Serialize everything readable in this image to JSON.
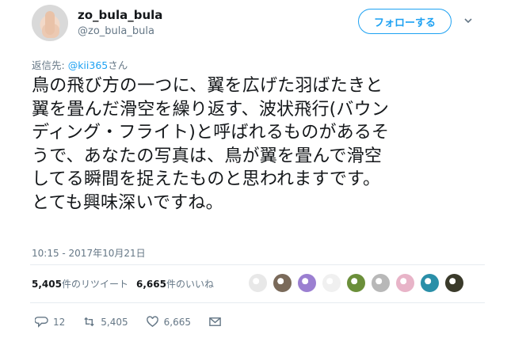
{
  "user": {
    "display_name": "zo_bula_bula",
    "handle": "@zo_bula_bula"
  },
  "follow_button": {
    "label": "フォローする"
  },
  "reply": {
    "prefix": "返信先: ",
    "mention": "@kii365",
    "suffix": "さん"
  },
  "tweet": {
    "lines": [
      "鳥の飛び方の一つに、翼を広げた羽ばたきと",
      "翼を畳んだ滑空を繰り返す、波状飛行(バウン",
      "ディング・フライト)と呼ばれるものがあるそ",
      "うで、あなたの写真は、鳥が翼を畳んで滑空",
      "してる瞬間を捉えたものと思われますです。",
      "とても興味深いですね。"
    ]
  },
  "timestamp": "10:15 - 2017年10月21日",
  "stats": {
    "retweets_count": "5,405",
    "retweets_label": "件のリツイート",
    "likes_count": "6,665",
    "likes_label": "件のいいね"
  },
  "likers": [
    {
      "icon": "avatar-mono",
      "color": "#e8e8e8"
    },
    {
      "icon": "avatar-photo",
      "color": "#7a6a5a"
    },
    {
      "icon": "avatar-purple",
      "color": "#9b7fd1"
    },
    {
      "icon": "avatar-eye",
      "color": "#f0f0f0"
    },
    {
      "icon": "avatar-green",
      "color": "#6b8f3a"
    },
    {
      "icon": "avatar-gray",
      "color": "#b8b8b8"
    },
    {
      "icon": "avatar-pink",
      "color": "#e8b4c8"
    },
    {
      "icon": "avatar-teal",
      "color": "#2a8fa8"
    },
    {
      "icon": "avatar-dark",
      "color": "#3a3a2a"
    }
  ],
  "actions": {
    "reply_count": "12",
    "retweet_count": "5,405",
    "like_count": "6,665"
  },
  "colors": {
    "accent": "#1da1f2",
    "muted": "#657786",
    "text": "#14171a",
    "divider": "#e6ecf0"
  }
}
